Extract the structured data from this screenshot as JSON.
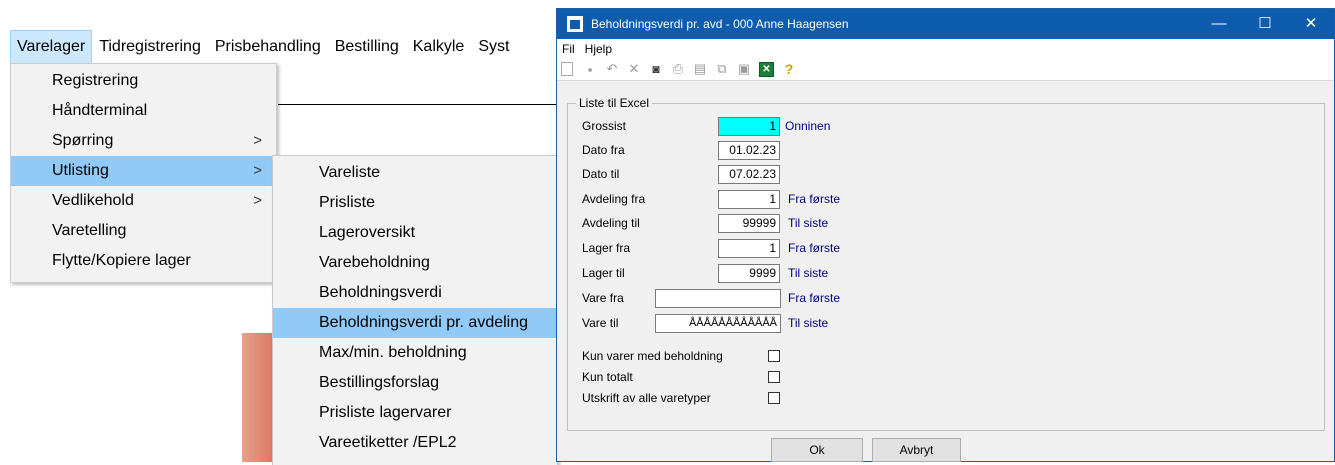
{
  "app_menu": [
    "Varelager",
    "Tidregistrering",
    "Prisbehandling",
    "Bestilling",
    "Kalkyle",
    "Syst"
  ],
  "varelager_menu": [
    {
      "label": "Registrering",
      "arrow": ""
    },
    {
      "label": "Håndterminal",
      "arrow": ""
    },
    {
      "label": "Spørring",
      "arrow": ">"
    },
    {
      "label": "Utlisting",
      "arrow": ">"
    },
    {
      "label": "Vedlikehold",
      "arrow": ">"
    },
    {
      "label": "Varetelling",
      "arrow": ""
    },
    {
      "label": "Flytte/Kopiere lager",
      "arrow": ""
    }
  ],
  "utlisting_menu": [
    "Vareliste",
    "Prisliste",
    "Lageroversikt",
    "Varebeholdning",
    "Beholdningsverdi",
    "Beholdningsverdi pr. avdeling",
    "Max/min. beholdning",
    "Bestillingsforslag",
    "Prisliste lagervarer",
    "Vareetiketter /EPL2"
  ],
  "dialog": {
    "title": "Beholdningsverdi pr. avd - 000 Anne Haagensen",
    "menu": [
      "Fil",
      "Hjelp"
    ],
    "window_controls": {
      "minimize": "—",
      "maximize": "☐",
      "close": "✕"
    },
    "group_label": "Liste til Excel",
    "fields": {
      "grossist": {
        "label": "Grossist",
        "value": "1",
        "hint": "Onninen"
      },
      "dato_fra": {
        "label": "Dato fra",
        "value": "01.02.23"
      },
      "dato_til": {
        "label": "Dato til",
        "value": "07.02.23"
      },
      "avdeling_fra": {
        "label": "Avdeling fra",
        "value": "1",
        "hint": "Fra første"
      },
      "avdeling_til": {
        "label": "Avdeling til",
        "value": "99999",
        "hint": "Til siste"
      },
      "lager_fra": {
        "label": "Lager fra",
        "value": "1",
        "hint": "Fra første"
      },
      "lager_til": {
        "label": "Lager til",
        "value": "9999",
        "hint": "Til siste"
      },
      "vare_fra": {
        "label": "Vare fra",
        "value": "",
        "hint": "Fra første"
      },
      "vare_til": {
        "label": "Vare til",
        "value": "ÅÅÅÅÅÅÅÅÅÅÅÅ",
        "hint": "Til siste"
      }
    },
    "checkboxes": {
      "kun_beholdning": {
        "label": "Kun varer med beholdning",
        "checked": false
      },
      "kun_totalt": {
        "label": "Kun totalt",
        "checked": false
      },
      "alle_varetyper": {
        "label": "Utskrift av alle varetyper",
        "checked": false
      }
    },
    "ok_label": "Ok",
    "cancel_label": "Avbryt"
  },
  "colors": {
    "titlebar": "#0e5cad",
    "menu_highlight": "#91c9f7",
    "active_field": "#00ffff",
    "hint_text": "#00007f"
  }
}
